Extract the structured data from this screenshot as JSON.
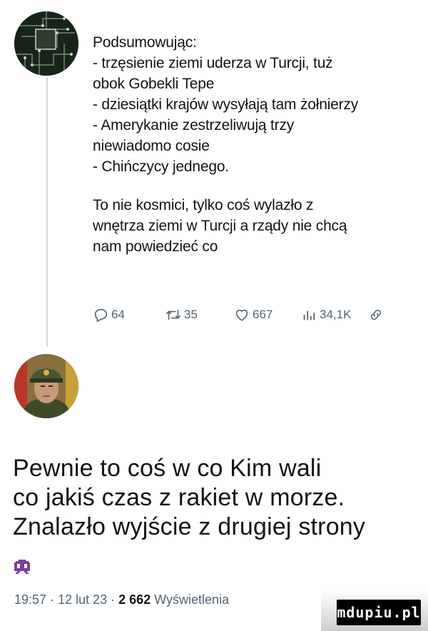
{
  "quoted_tweet": {
    "lines": [
      "Podsumowując:",
      "- trzęsienie ziemi uderza w Turcji, tuż",
      "obok Gobekli Tepe",
      "- dziesiątki krajów wysyłają tam żołnierzy",
      "- Amerykanie zestrzeliwują trzy",
      "niewiadomo cosie",
      "- Chińczycy jednego.",
      "To nie kosmici, tylko coś wylazło z",
      "wnętrza ziemi w Turcji a rządy nie chcą",
      "nam powiedzieć co"
    ],
    "actions": {
      "replies": "64",
      "retweets": "35",
      "likes": "667",
      "views": "34,1K"
    }
  },
  "reply_tweet": {
    "lines": [
      "Pewnie to coś w co Kim wali",
      "co jakiś czas z rakiet w morze.",
      "Znalazło wyjście z drugiej strony"
    ],
    "emoji": "alien-monster-icon",
    "time": "19:57",
    "date": "12 lut 23",
    "views_count": "2 662",
    "views_label": "Wyświetlenia"
  },
  "watermark": "mdupiu.pl",
  "colors": {
    "text": "#0f1419",
    "muted": "#536471",
    "thread_line": "#cfd9de"
  }
}
